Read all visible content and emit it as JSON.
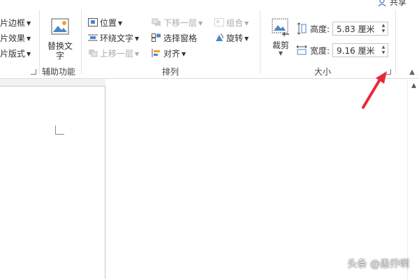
{
  "header": {
    "share_label": "共享"
  },
  "picture_styles": {
    "items": [
      "片边框",
      "片效果",
      "片版式"
    ]
  },
  "accessibility": {
    "alt_text_button": "替换文字",
    "group_label": "辅助功能"
  },
  "arrange": {
    "position": "位置",
    "wrap_text": "环绕文字",
    "bring_forward": "上移一层",
    "send_backward": "下移一层",
    "selection_pane": "选择窗格",
    "align": "对齐",
    "group": "组合",
    "rotate": "旋转",
    "group_label": "排列"
  },
  "size": {
    "crop_label": "裁剪",
    "height_label": "高度:",
    "height_value": "5.83 厘米",
    "width_label": "宽度:",
    "width_value": "9.16 厘米",
    "group_label": "大小"
  },
  "watermark": "头条 @愚乔啊",
  "colors": {
    "accent_arrow": "#e8293a"
  }
}
